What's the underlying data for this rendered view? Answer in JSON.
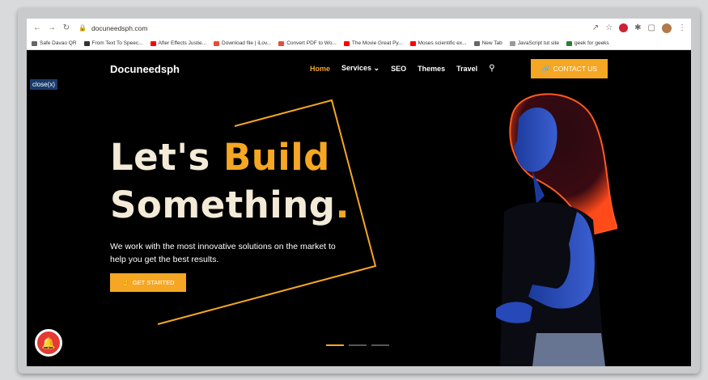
{
  "browser": {
    "url": "docuneedsph.com",
    "bookmarks": [
      {
        "label": "Safe Davao QR",
        "color": "#666666"
      },
      {
        "label": "From Text To Speec...",
        "color": "#333333"
      },
      {
        "label": "After Effects Justie...",
        "color": "#ff0000"
      },
      {
        "label": "Download file | iLov...",
        "color": "#e74c3c"
      },
      {
        "label": "Convert PDF to Wo...",
        "color": "#e74c3c"
      },
      {
        "label": "The Movie Great Py...",
        "color": "#ff0000"
      },
      {
        "label": "Moses scientific ex...",
        "color": "#ff0000"
      },
      {
        "label": "New Tab",
        "color": "#666666"
      },
      {
        "label": "JavaScript tut site",
        "color": "#999999"
      },
      {
        "label": "geek for geeks",
        "color": "#2e7d32"
      }
    ]
  },
  "site": {
    "logo": "Docuneedsph",
    "nav": {
      "home": "Home",
      "services": "Services",
      "seo": "SEO",
      "themes": "Themes",
      "travel": "Travel"
    },
    "contact_label": "CONTACT US",
    "close_label": "close(x)",
    "headline_1_a": "Let's ",
    "headline_1_b": "Build",
    "headline_2_a": "Something",
    "headline_2_b": ".",
    "subtext": "We work with the most innovative solutions on the market to help you get the best results.",
    "cta_label": "GET STARTED",
    "colors": {
      "accent": "#f5a623",
      "background": "#000000",
      "headline": "#f3ead8"
    }
  }
}
